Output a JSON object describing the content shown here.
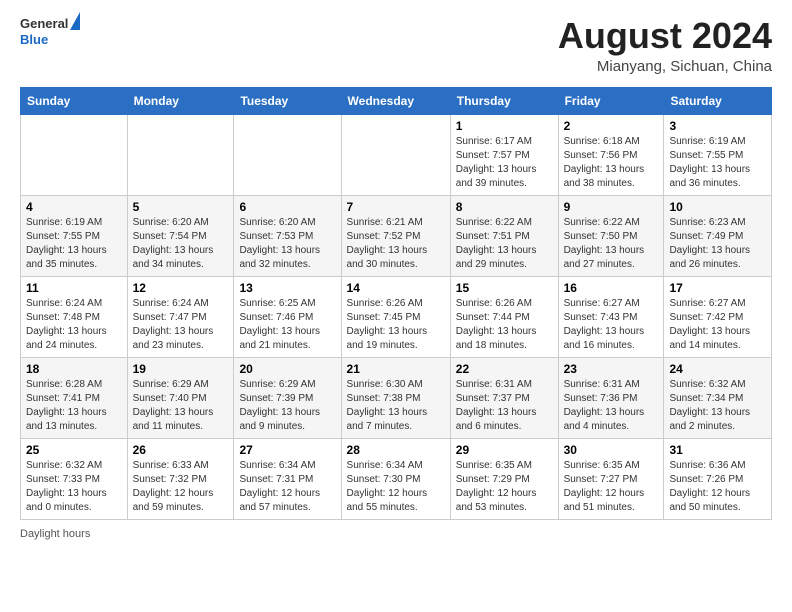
{
  "header": {
    "logo": {
      "line1": "General",
      "line2": "Blue"
    },
    "title": "August 2024",
    "location": "Mianyang, Sichuan, China"
  },
  "weekdays": [
    "Sunday",
    "Monday",
    "Tuesday",
    "Wednesday",
    "Thursday",
    "Friday",
    "Saturday"
  ],
  "weeks": [
    [
      {
        "day": "",
        "info": ""
      },
      {
        "day": "",
        "info": ""
      },
      {
        "day": "",
        "info": ""
      },
      {
        "day": "",
        "info": ""
      },
      {
        "day": "1",
        "info": "Sunrise: 6:17 AM\nSunset: 7:57 PM\nDaylight: 13 hours\nand 39 minutes."
      },
      {
        "day": "2",
        "info": "Sunrise: 6:18 AM\nSunset: 7:56 PM\nDaylight: 13 hours\nand 38 minutes."
      },
      {
        "day": "3",
        "info": "Sunrise: 6:19 AM\nSunset: 7:55 PM\nDaylight: 13 hours\nand 36 minutes."
      }
    ],
    [
      {
        "day": "4",
        "info": "Sunrise: 6:19 AM\nSunset: 7:55 PM\nDaylight: 13 hours\nand 35 minutes."
      },
      {
        "day": "5",
        "info": "Sunrise: 6:20 AM\nSunset: 7:54 PM\nDaylight: 13 hours\nand 34 minutes."
      },
      {
        "day": "6",
        "info": "Sunrise: 6:20 AM\nSunset: 7:53 PM\nDaylight: 13 hours\nand 32 minutes."
      },
      {
        "day": "7",
        "info": "Sunrise: 6:21 AM\nSunset: 7:52 PM\nDaylight: 13 hours\nand 30 minutes."
      },
      {
        "day": "8",
        "info": "Sunrise: 6:22 AM\nSunset: 7:51 PM\nDaylight: 13 hours\nand 29 minutes."
      },
      {
        "day": "9",
        "info": "Sunrise: 6:22 AM\nSunset: 7:50 PM\nDaylight: 13 hours\nand 27 minutes."
      },
      {
        "day": "10",
        "info": "Sunrise: 6:23 AM\nSunset: 7:49 PM\nDaylight: 13 hours\nand 26 minutes."
      }
    ],
    [
      {
        "day": "11",
        "info": "Sunrise: 6:24 AM\nSunset: 7:48 PM\nDaylight: 13 hours\nand 24 minutes."
      },
      {
        "day": "12",
        "info": "Sunrise: 6:24 AM\nSunset: 7:47 PM\nDaylight: 13 hours\nand 23 minutes."
      },
      {
        "day": "13",
        "info": "Sunrise: 6:25 AM\nSunset: 7:46 PM\nDaylight: 13 hours\nand 21 minutes."
      },
      {
        "day": "14",
        "info": "Sunrise: 6:26 AM\nSunset: 7:45 PM\nDaylight: 13 hours\nand 19 minutes."
      },
      {
        "day": "15",
        "info": "Sunrise: 6:26 AM\nSunset: 7:44 PM\nDaylight: 13 hours\nand 18 minutes."
      },
      {
        "day": "16",
        "info": "Sunrise: 6:27 AM\nSunset: 7:43 PM\nDaylight: 13 hours\nand 16 minutes."
      },
      {
        "day": "17",
        "info": "Sunrise: 6:27 AM\nSunset: 7:42 PM\nDaylight: 13 hours\nand 14 minutes."
      }
    ],
    [
      {
        "day": "18",
        "info": "Sunrise: 6:28 AM\nSunset: 7:41 PM\nDaylight: 13 hours\nand 13 minutes."
      },
      {
        "day": "19",
        "info": "Sunrise: 6:29 AM\nSunset: 7:40 PM\nDaylight: 13 hours\nand 11 minutes."
      },
      {
        "day": "20",
        "info": "Sunrise: 6:29 AM\nSunset: 7:39 PM\nDaylight: 13 hours\nand 9 minutes."
      },
      {
        "day": "21",
        "info": "Sunrise: 6:30 AM\nSunset: 7:38 PM\nDaylight: 13 hours\nand 7 minutes."
      },
      {
        "day": "22",
        "info": "Sunrise: 6:31 AM\nSunset: 7:37 PM\nDaylight: 13 hours\nand 6 minutes."
      },
      {
        "day": "23",
        "info": "Sunrise: 6:31 AM\nSunset: 7:36 PM\nDaylight: 13 hours\nand 4 minutes."
      },
      {
        "day": "24",
        "info": "Sunrise: 6:32 AM\nSunset: 7:34 PM\nDaylight: 13 hours\nand 2 minutes."
      }
    ],
    [
      {
        "day": "25",
        "info": "Sunrise: 6:32 AM\nSunset: 7:33 PM\nDaylight: 13 hours\nand 0 minutes."
      },
      {
        "day": "26",
        "info": "Sunrise: 6:33 AM\nSunset: 7:32 PM\nDaylight: 12 hours\nand 59 minutes."
      },
      {
        "day": "27",
        "info": "Sunrise: 6:34 AM\nSunset: 7:31 PM\nDaylight: 12 hours\nand 57 minutes."
      },
      {
        "day": "28",
        "info": "Sunrise: 6:34 AM\nSunset: 7:30 PM\nDaylight: 12 hours\nand 55 minutes."
      },
      {
        "day": "29",
        "info": "Sunrise: 6:35 AM\nSunset: 7:29 PM\nDaylight: 12 hours\nand 53 minutes."
      },
      {
        "day": "30",
        "info": "Sunrise: 6:35 AM\nSunset: 7:27 PM\nDaylight: 12 hours\nand 51 minutes."
      },
      {
        "day": "31",
        "info": "Sunrise: 6:36 AM\nSunset: 7:26 PM\nDaylight: 12 hours\nand 50 minutes."
      }
    ]
  ],
  "footer": {
    "note": "Daylight hours"
  },
  "colors": {
    "header_bg": "#2a6fc4",
    "accent": "#1a69c4"
  }
}
